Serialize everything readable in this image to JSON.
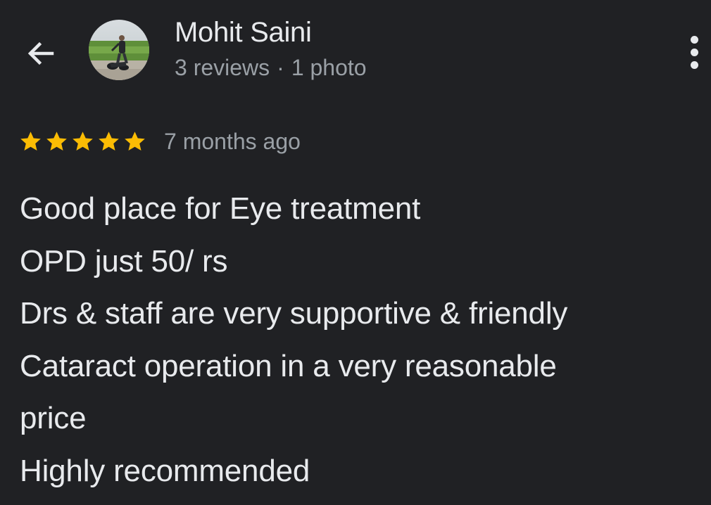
{
  "header": {
    "back_icon": "arrow-back-icon",
    "author": {
      "name": "Mohit Saini",
      "reviews": "3 reviews",
      "separator": "·",
      "photos": "1 photo"
    },
    "more_icon": "more-vert-icon"
  },
  "review": {
    "rating": 5,
    "max_rating": 5,
    "star_color": "#fbbc04",
    "time": "7 months ago",
    "lines": [
      "Good place for Eye treatment",
      "OPD just 50/ rs",
      "Drs & staff are very supportive & friendly",
      "Cataract operation in a very reasonable",
      "price",
      "Highly recommended"
    ]
  },
  "theme": {
    "background": "#202124",
    "text_primary": "#e8eaed",
    "text_secondary": "#9aa0a6"
  }
}
